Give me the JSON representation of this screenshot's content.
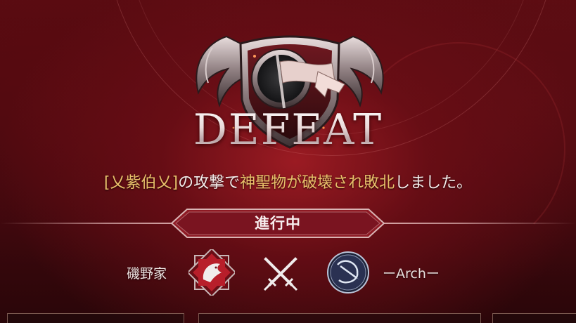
{
  "result": {
    "title": "DEFEAT"
  },
  "message": {
    "attacker": "[乂紫伯乂]",
    "text1": "の攻撃で",
    "object": "神聖物が破壊され敗北",
    "text2": "しました。"
  },
  "status": {
    "label": "進行中"
  },
  "teams": {
    "left": {
      "name": "磯野家",
      "crest": "dragon-crest-icon"
    },
    "vs_icon": "crossed-swords-icon",
    "right": {
      "name": "ーArchー",
      "crest": "bow-crest-icon"
    }
  },
  "colors": {
    "highlight": "#e8c06a",
    "background": "#4a0a10",
    "text": "#f3ecea"
  }
}
